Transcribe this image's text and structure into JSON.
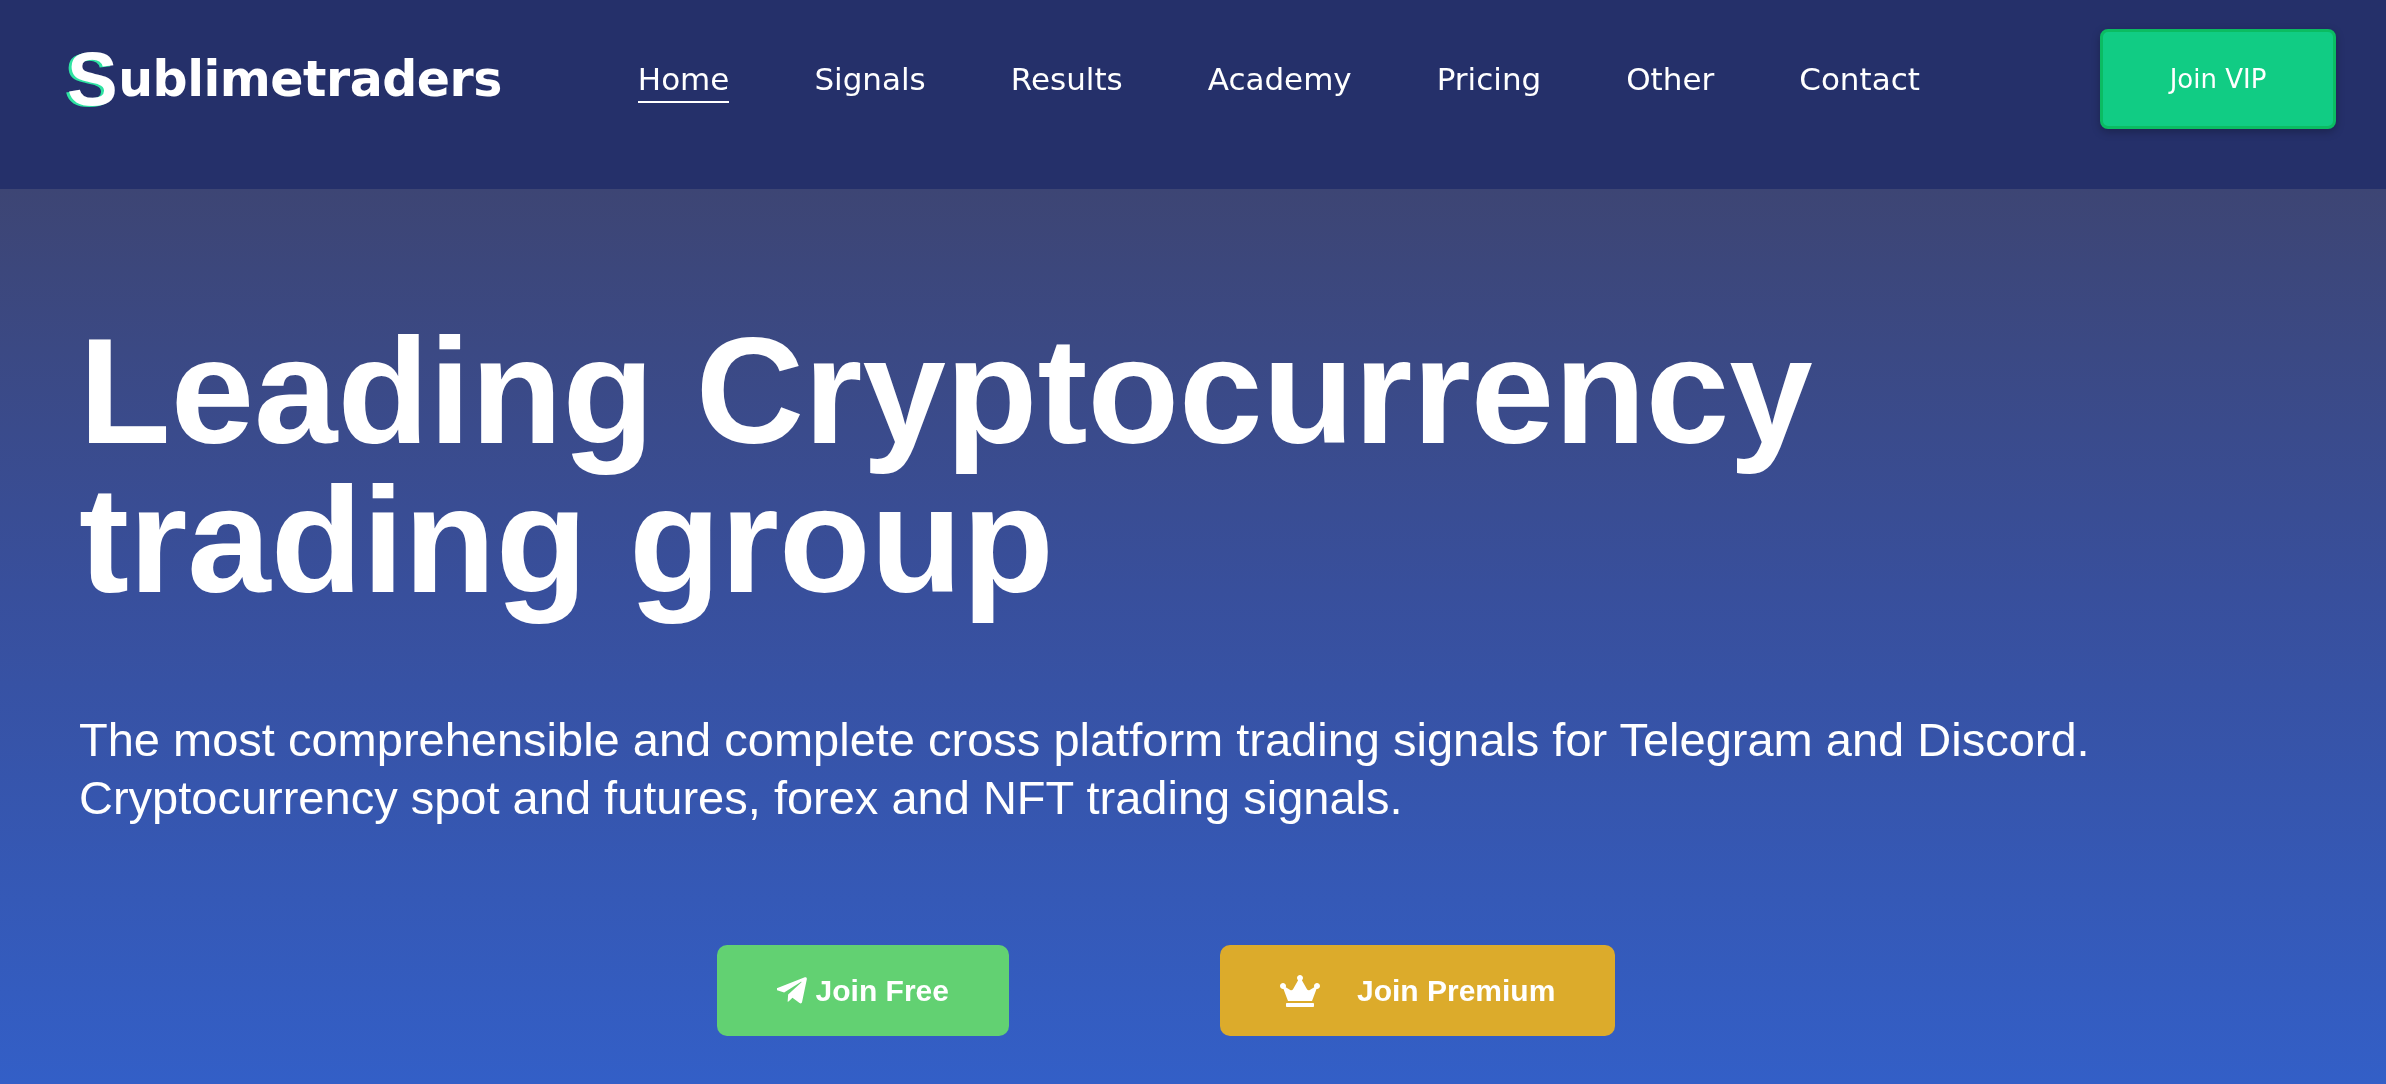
{
  "header": {
    "logo": "Sublimetraders",
    "nav": [
      {
        "label": "Home",
        "selected": true
      },
      {
        "label": "Signals",
        "selected": false
      },
      {
        "label": "Results",
        "selected": false
      },
      {
        "label": "Academy",
        "selected": false
      },
      {
        "label": "Pricing",
        "selected": false
      },
      {
        "label": "Other",
        "selected": false
      },
      {
        "label": "Contact",
        "selected": false
      }
    ],
    "cta": "Join VIP"
  },
  "hero": {
    "heading": "Leading Cryptocurrency trading group",
    "subtitle": "The most comprehensible and complete cross platform trading signals for Telegram and Discord. Cryptocurrency spot and futures, forex and NFT trading signals.",
    "buttons": [
      {
        "kind": "free",
        "label": "Join Free"
      },
      {
        "kind": "premium",
        "label": "Join Premium"
      }
    ]
  }
}
